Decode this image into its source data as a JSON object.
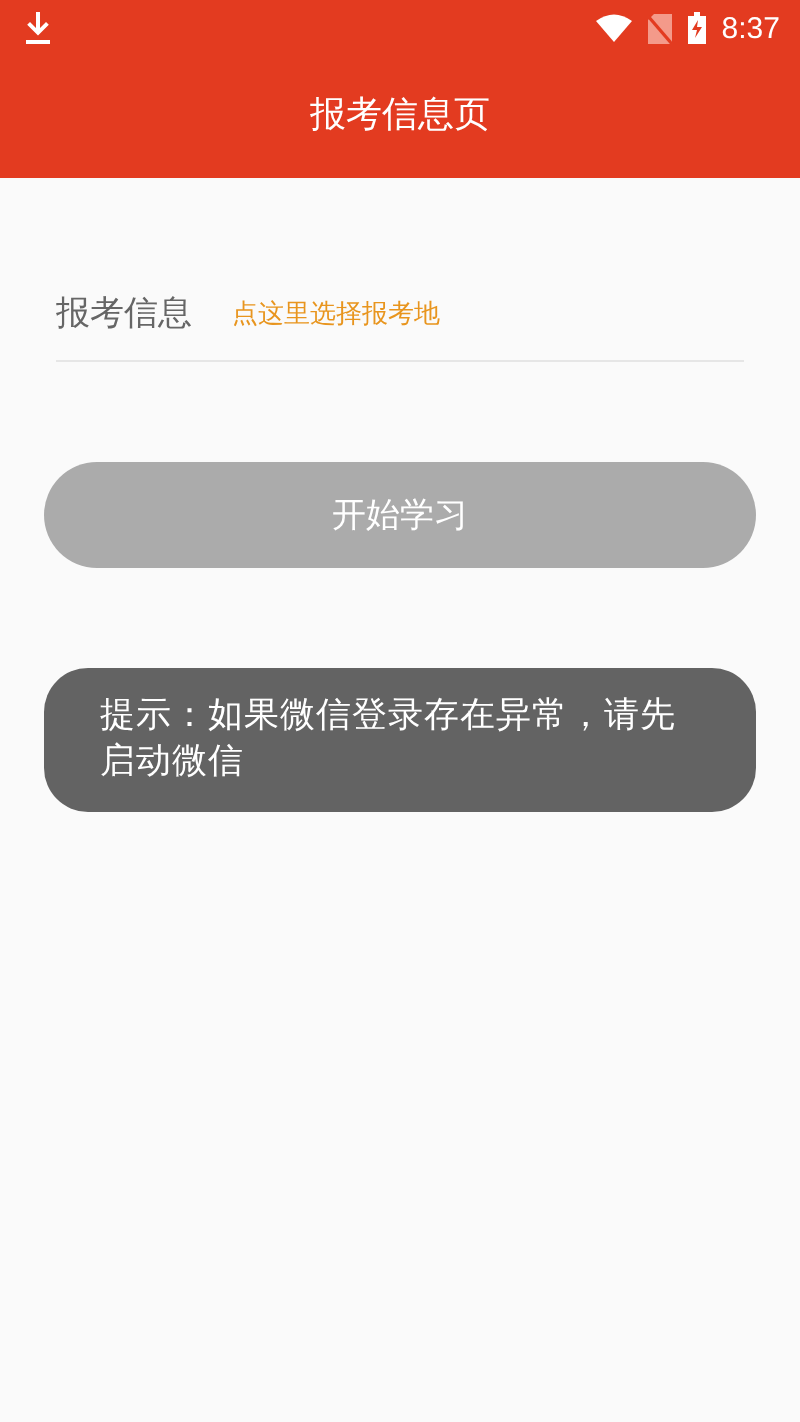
{
  "status_bar": {
    "time": "8:37"
  },
  "header": {
    "title": "报考信息页"
  },
  "form": {
    "label": "报考信息",
    "link": "点这里选择报考地"
  },
  "start_button": {
    "label": "开始学习",
    "disabled": true
  },
  "toast": {
    "text": "提示：如果微信登录存在异常，请先启动微信"
  }
}
